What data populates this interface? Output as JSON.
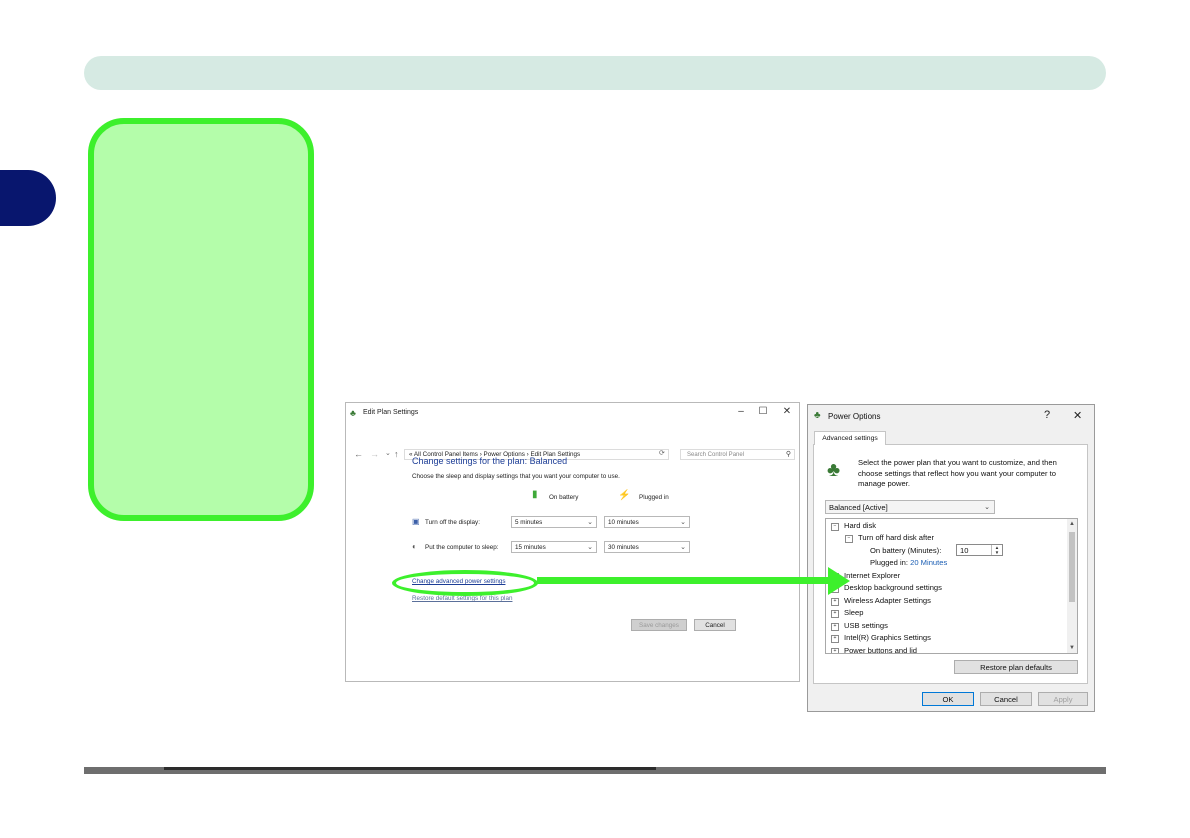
{
  "edit_plan_settings": {
    "title": "Edit Plan Settings",
    "nav": {
      "back": "←",
      "forward": "→",
      "recent": "⌄",
      "up": "↑"
    },
    "breadcrumb": "« All Control Panel Items  ›  Power Options  ›  Edit Plan Settings",
    "search_placeholder": "Search Control Panel",
    "heading": "Change settings for the plan: Balanced",
    "subtext": "Choose the sleep and display settings that you want your computer to use.",
    "columns": {
      "battery": "On battery",
      "plugged": "Plugged in"
    },
    "display_label": "Turn off the display:",
    "display_battery": "5 minutes",
    "display_plugged": "10 minutes",
    "sleep_label": "Put the computer to sleep:",
    "sleep_battery": "15 minutes",
    "sleep_plugged": "30 minutes",
    "advanced_link": "Change advanced power settings",
    "restore_link": "Restore default settings for this plan",
    "save_button": "Save changes",
    "cancel_button": "Cancel"
  },
  "power_options": {
    "title": "Power Options",
    "help": "?",
    "close": "✕",
    "tab": "Advanced settings",
    "intro": "Select the power plan that you want to customize, and then choose settings that reflect how you want your computer to manage power.",
    "plan_selected": "Balanced [Active]",
    "tree": {
      "hard_disk": "Hard disk",
      "turn_off_after": "Turn off hard disk after",
      "on_battery_label": "On battery (Minutes):",
      "on_battery_value": "10",
      "plugged_in_label": "Plugged in:",
      "plugged_in_value": "20 Minutes",
      "internet_explorer": "Internet Explorer",
      "desktop_background": "Desktop background settings",
      "wireless_adapter": "Wireless Adapter Settings",
      "sleep": "Sleep",
      "usb": "USB settings",
      "graphics": "Intel(R) Graphics Settings",
      "power_buttons": "Power buttons and lid"
    },
    "restore_button": "Restore plan defaults",
    "ok_button": "OK",
    "cancel_button": "Cancel",
    "apply_button": "Apply"
  },
  "colors": {
    "callout_fill": "#b4fdaa",
    "callout_border": "#3df02c",
    "chapter_tab": "#08166e",
    "header_bar": "#d6eae3",
    "link_blue": "#1c3d96"
  }
}
